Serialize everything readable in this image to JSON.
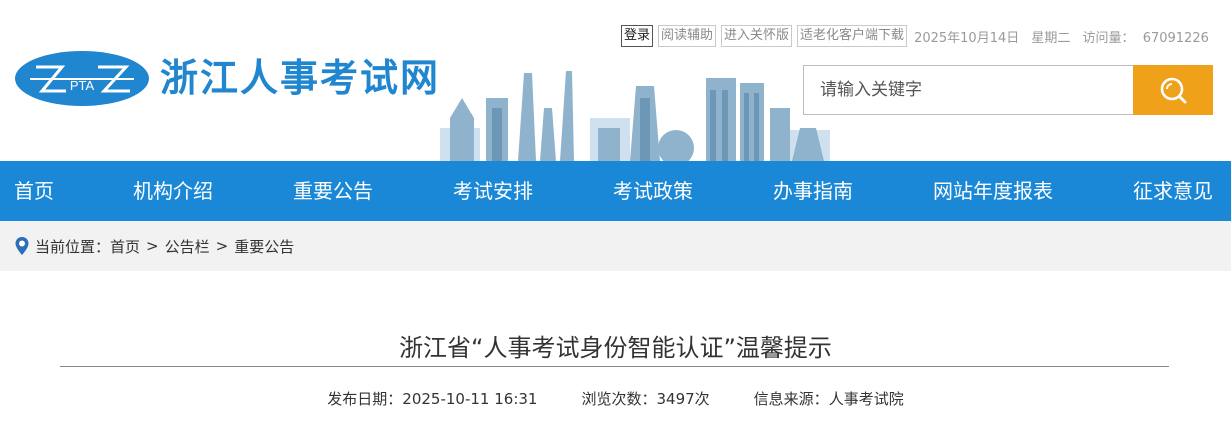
{
  "header": {
    "logo_text": "PTA",
    "site_title": "浙江人事考试网",
    "top_links": [
      "登录",
      "阅读辅助",
      "进入关怀版",
      "适老化客户端下载"
    ],
    "date": "2025年10月14日",
    "weekday": "星期二",
    "visits_label": "访问量：",
    "visits_value": "67091226",
    "search_placeholder": "请输入关键字"
  },
  "nav": [
    "首页",
    "机构介绍",
    "重要公告",
    "考试安排",
    "考试政策",
    "办事指南",
    "网站年度报表",
    "征求意见"
  ],
  "breadcrumb": {
    "label": "当前位置：",
    "items": [
      "首页",
      "公告栏",
      "重要公告"
    ],
    "separator": ">"
  },
  "article": {
    "title": "浙江省“人事考试身份智能认证”温馨提示",
    "date_label": "发布日期：",
    "date_value": "2025-10-11 16:31",
    "views_label": "浏览次数：",
    "views_value": "3497次",
    "source_label": "信息来源：",
    "source_value": "人事考试院"
  },
  "colors": {
    "brand_blue": "#1a88d6",
    "search_orange": "#f0a11a",
    "breadcrumb_bg": "#f2f2f2"
  },
  "icons": [
    "logo-emblem-icon",
    "search-icon",
    "location-pin-icon"
  ]
}
